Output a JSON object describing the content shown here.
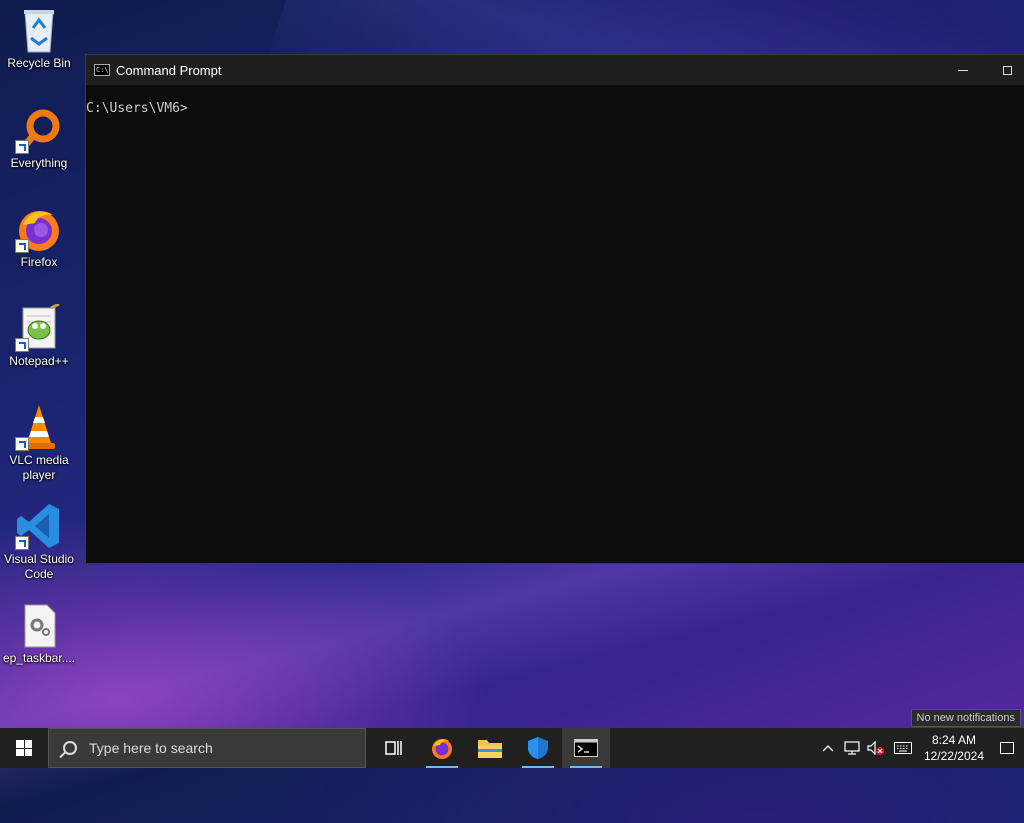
{
  "desktop": {
    "icons": [
      {
        "label": "Recycle Bin"
      },
      {
        "label": "Everything"
      },
      {
        "label": "Firefox"
      },
      {
        "label": "Notepad++"
      },
      {
        "label": "VLC media player"
      },
      {
        "label": "Visual Studio Code"
      },
      {
        "label": "ep_taskbar...."
      }
    ]
  },
  "window": {
    "title": "Command Prompt",
    "console_text": "C:\\Users\\VM6>"
  },
  "taskbar": {
    "search_placeholder": "Type here to search",
    "clock_time": "8:24 AM",
    "clock_date": "12/22/2024",
    "tooltip": "No new notifications"
  }
}
